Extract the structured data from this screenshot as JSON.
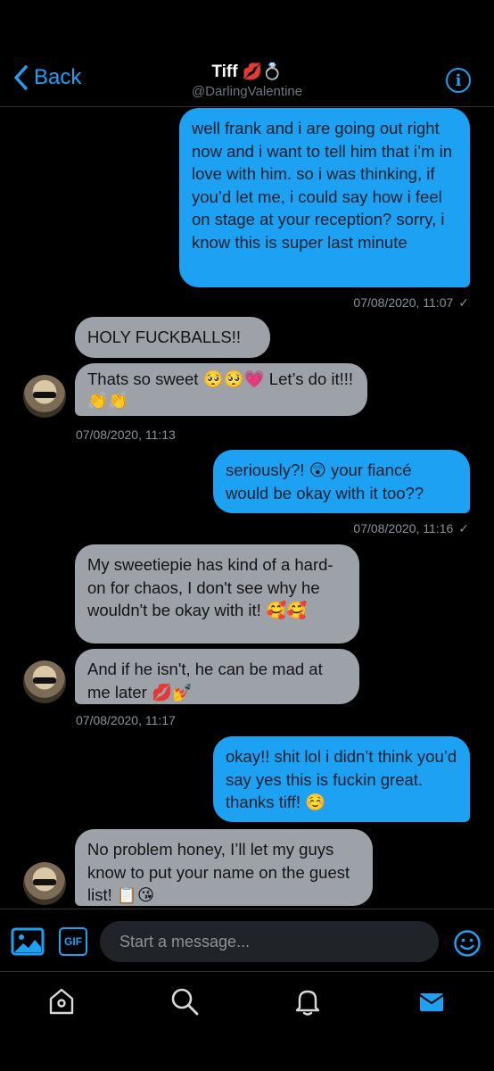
{
  "header": {
    "back_label": "Back",
    "name": "Tiff",
    "name_emoji": "💋💍",
    "handle": "@DarlingValentine",
    "info_label": "i"
  },
  "messages": [
    {
      "dir": "out",
      "text": "well frank and i are going out right now and i want to tell him that  i’m in love with him. so i was thinking, if you’d let me, i could say how i feel on stage at your reception? sorry, i know this is super last minute"
    },
    {
      "meta": "07/08/2020, 11:07",
      "read": true
    },
    {
      "dir": "in",
      "text": "HOLY FUCKBALLS!!"
    },
    {
      "dir": "in",
      "text": "Thats so sweet 🥺🥺💗 Let’s do it!!! 👏👏"
    },
    {
      "meta": "07/08/2020, 11:13"
    },
    {
      "dir": "out",
      "text": "seriously?! 😲 your fiancé would be okay with it too??"
    },
    {
      "meta": "07/08/2020, 11:16",
      "read": true
    },
    {
      "dir": "in",
      "text": "My sweetiepie has kind of a hard-on for chaos, I don't see why he wouldn't be okay with it! 🥰🥰"
    },
    {
      "dir": "in",
      "text": "And if he isn't, he can be mad at me later 💋💅"
    },
    {
      "meta": "07/08/2020, 11:17"
    },
    {
      "dir": "out",
      "text": "okay!! shit lol i didn’t think you’d say yes this is fuckin great. thanks tiff! ☺️"
    },
    {
      "dir": "in",
      "text": "No problem honey, I’ll let my guys know to put your name on the guest list! 📋😘"
    }
  ],
  "composer": {
    "placeholder": "Start a message...",
    "gif_label": "GIF"
  },
  "colors": {
    "accent": "#1da1f2",
    "incoming_bubble": "#9ca2a8",
    "background": "#000000"
  },
  "tabs": [
    "home-icon",
    "search-icon",
    "notifications-icon",
    "messages-icon"
  ]
}
